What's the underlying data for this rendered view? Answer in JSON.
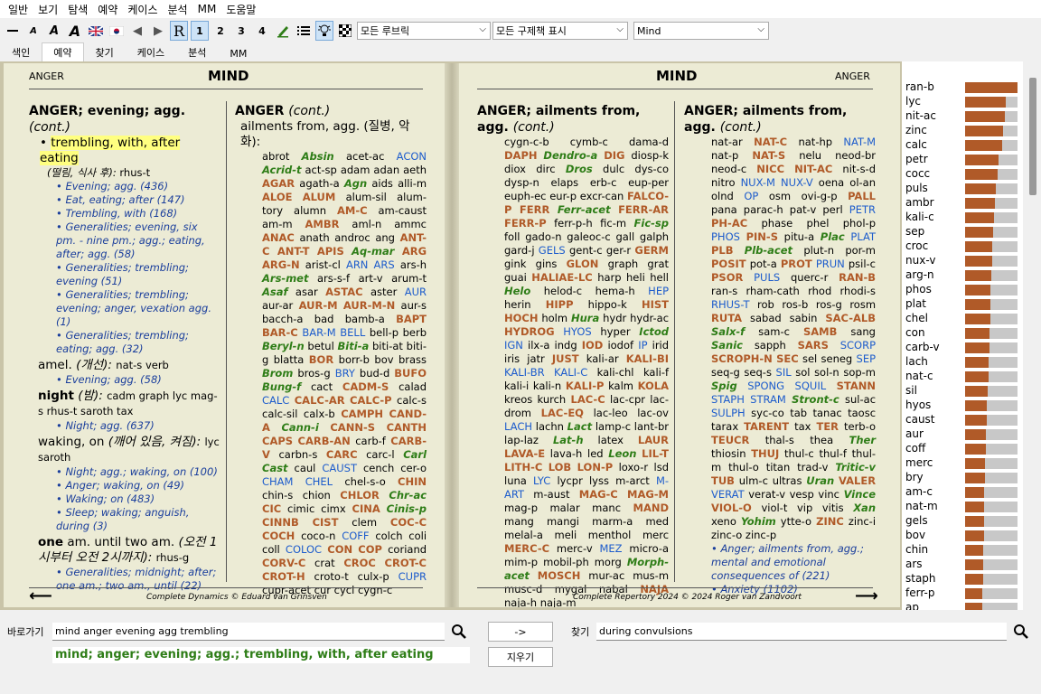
{
  "menu": [
    "일반",
    "보기",
    "탐색",
    "예약",
    "케이스",
    "분석",
    "MM",
    "도움말"
  ],
  "toolbar": {
    "r": "R",
    "n1": "1",
    "n2": "2",
    "n3": "3",
    "n4": "4",
    "rubric_select": "모든 루브릭",
    "remedy_select": "모든 구제책 표시",
    "chapter_select": "Mind"
  },
  "tabs": [
    "색인",
    "예약",
    "찾기",
    "케이스",
    "분석",
    "MM"
  ],
  "left_page": {
    "header_left": "ANGER",
    "title": "MIND",
    "col1": [
      {
        "t": "hd",
        "html": "ANGER; evening; agg. <i>(cont.)</i>"
      },
      {
        "t": "sel",
        "html": "• <span class='hl'>trembling, with, after eating</span>"
      },
      {
        "t": "p",
        "html": "<i style='padding-left:10px'>(떨림, 식사 후):</i> rhus-t"
      },
      {
        "t": "x",
        "html": "• Evening; agg. (436)"
      },
      {
        "t": "x",
        "html": "• Eat, eating; after (147)"
      },
      {
        "t": "x",
        "html": "• Trembling, with (168)"
      },
      {
        "t": "x",
        "html": "• Generalities; evening, six pm. - nine pm.; agg.; eating, after; agg. (58)"
      },
      {
        "t": "x",
        "html": "• Generalities; trembling; evening (51)"
      },
      {
        "t": "x",
        "html": "• Generalities; trembling; evening; anger, vexation agg. (1)"
      },
      {
        "t": "x",
        "html": "• Generalities; trembling; eating; agg. (32)"
      },
      {
        "t": "sub",
        "html": "amel. <i>(개선):</i> nat-s verb"
      },
      {
        "t": "x",
        "html": "• Evening; agg. (58)"
      },
      {
        "t": "sub",
        "html": "<b>night</b> <i>(밤):</i> cadm graph lyc mag-s rhus-t saroth tax"
      },
      {
        "t": "x",
        "html": "• Night; agg. (637)"
      },
      {
        "t": "sub",
        "html": "waking, on <i>(깨어 있음, 켜짐):</i> lyc saroth"
      },
      {
        "t": "x",
        "html": "• Night; agg.; waking, on (100)"
      },
      {
        "t": "x",
        "html": "• Anger; waking, on (49)"
      },
      {
        "t": "x",
        "html": "• Waking; on (483)"
      },
      {
        "t": "x",
        "html": "• Sleep; waking; anguish, during (3)"
      },
      {
        "t": "sub",
        "html": "<b>one</b> am. until two am. <i>(오전 1시부터 오전 2시까지):</i> rhus-g"
      },
      {
        "t": "x",
        "html": "• Generalities; midnight; after; one am.; two am., until (22)"
      }
    ],
    "col2_head": "ANGER (cont.)",
    "col2_sub": "ailments from, agg. (질병, 악화):",
    "col2_body": "abrot <g4>Absin</g4> acet-ac <g2>ACON</g2> <g4>Acrid-t</g4> act-sp adam adan aeth <g3>AGAR</g3> agath-a <g4>Agn</g4> aids alli-m <g3>ALOE ALUM</g3> alum-sil alum-tory alumn <g3>AM-C</g3> am-caust am-m <g3>AMBR</g3> aml-n ammc <g3>ANAC</g3> anath androc ang <g3>ANT-C ANT-T APIS</g3> <g4>Aq-mar</g4> <g3>ARG ARG-N</g3> arist-cl <g2>ARN ARS</g2> ars-h <g4>Ars-met</g4> ars-s-f art-v arum-t <g4>Asaf</g4> asar <g3>ASTAC</g3> aster <g2>AUR</g2> aur-ar <g3>AUR-M AUR-M-N</g3> aur-s bacch-a bad bamb-a <g3>BAPT BAR-C</g3> <g2>BAR-M BELL</g2> bell-p berb <g4>Beryl-n</g4> betul <g4>Biti-a</g4> biti-at biti-g blatta <g3>BOR</g3> borr-b bov brass <g4>Brom</g4> bros-g <g2>BRY</g2> bud-d <g3>BUFO</g3> <g4>Bung-f</g4> cact <g3>CADM-S</g3> calad <g2>CALC</g2> <g3>CALC-AR CALC-P</g3> calc-s calc-sil calx-b <g3>CAMPH CAND-A</g3> <g4>Cann-i</g4> <g3>CANN-S CANTH CAPS CARB-AN</g3> carb-f <g3>CARB-V</g3> carbn-s <g3>CARC</g3> carc-l <g4>Carl Cast</g4> caul <g2>CAUST</g2> cench cer-o <g2>CHAM CHEL</g2> chel-s-o <g3>CHIN</g3> chin-s chion <g3>CHLOR</g3> <g4>Chr-ac</g4> <g3>CIC</g3> cimic cimx <g3>CINA</g3> <g4>Cinis-p</g4> <g3>CINNB CIST</g3> clem <g3>COC-C COCH</g3> coco-n <g2>COFF</g2> colch coli coll <g2>COLOC</g2> <g3>CON COP</g3> coriand <g3>CORV-C</g3> crat <g3>CROC CROT-C CROT-H</g3> croto-t culx-p <g2>CUPR</g2> cupr-acet cur cycl cygn-c",
    "footer": "Complete Dynamics © Eduard van Grinsven"
  },
  "right_page": {
    "title": "MIND",
    "header_right": "ANGER",
    "col1_head": "ANGER; ailments from, agg. (cont.)",
    "col1_body": "cygn-c-b cymb-c dama-d <g3>DAPH</g3> <g4>Dendro-a</g4> <g3>DIG</g3> diosp-k diox dirc <g4>Dros</g4> dulc dys-co dysp-n elaps erb-c eup-per euph-ec eur-p excr-can <g3>FALCO-P FERR</g3> <g4>Ferr-acet</g4> <g3>FERR-AR FERR-P</g3> ferr-p-h fic-m <g4>Fic-sp</g4> foll gado-n galeoc-c gall galph gard-j <g2>GELS</g2> gent-c ger-r <g3>GERM</g3> gink gins <g3>GLON</g3> graph grat guai <g3>HALIAE-LC</g3> harp heli hell <g4>Helo</g4> helod-c hema-h <g2>HEP</g2> herin <g3>HIPP</g3> hippo-k <g3>HIST HOCH</g3> holm <g4>Hura</g4> hydr hydr-ac <g3>HYDROG</g3> <g2>HYOS</g2> hyper <g4>Ictod</g4> <g2>IGN</g2> ilx-a indg <g3>IOD</g3> iodof <g2>IP</g2> irid iris jatr <g3>JUST</g3> kali-ar <g3>KALI-BI</g3> <g2>KALI-BR KALI-C</g2> kali-chl kali-f kali-i kali-n <g3>KALI-P</g3> kalm <g3>KOLA</g3> kreos kurch <g3>LAC-C</g3> lac-cpr lac-drom <g3>LAC-EQ</g3> lac-leo lac-ov <g2>LACH</g2> lachn <g4>Lact</g4> lamp-c lant-br lap-laz <g4>Lat-h</g4> latex <g3>LAUR LAVA-E</g3> lava-h led <g4>Leon</g4> <g3>LIL-T LITH-C LOB LON-P</g3> loxo-r lsd luna <g2>LYC</g2> lycpr lyss m-arct <g2>M-ART</g2> m-aust <g3>MAG-C MAG-M</g3> mag-p malar manc <g3>MAND</g3> mang mangi marm-a med melal-a meli menthol merc <g3>MERC-C</g3> merc-v <g2>MEZ</g2> micro-a mim-p mobil-ph morg <g4>Morph-acet</g4> <g3>MOSCH</g3> mur-ac mus-m musc-d mygal nabal <g3>NAJA</g3> naja-h naja-m",
    "col2_head": "ANGER; ailments from, agg. (cont.)",
    "col2_body": "nat-ar <g3>NAT-C</g3> nat-hp <g2>NAT-M</g2> nat-p <g3>NAT-S</g3> nelu neod-br neod-c <g3>NICC NIT-AC</g3> nit-s-d nitro <g2>NUX-M NUX-V</g2> oena ol-an olnd <g2>OP</g2> osm ovi-g-p <g3>PALL</g3> pana parac-h pat-v perl <g2>PETR</g2> <g3>PH-AC</g3> phase phel phol-p <g2>PHOS</g2> <g3>PIN-S</g3> pitu-a <g4>Plac</g4> <g2>PLAT</g2> <g3>PLB</g3> <g4>Plb-acet</g4> plut-n por-m <g3>POSIT</g3> pot-a <g3>PROT</g3> <g2>PRUN</g2> psil-c <g3>PSOR</g3> <g2>PULS</g2> querc-r <g3>RAN-B</g3> ran-s rham-cath rhod rhodi-s <g2>RHUS-T</g2> rob ros-b ros-g rosm <g3>RUTA</g3> sabad sabin <g3>SAC-ALB</g3> <g4>Salx-f</g4> sam-c <g3>SAMB</g3> sang <g4>Sanic</g4> sapph <g3>SARS</g3> <g2>SCORP</g2> <g3>SCROPH-N SEC</g3> sel seneg <g2>SEP</g2> seq-g seq-s <g2>SIL</g2> sol sol-n sop-m <g4>Spig</g4> <g2>SPONG SQUIL</g2> <g3>STANN</g3> <g2>STAPH STRAM</g2> <g4>Stront-c</g4> sul-ac <g2>SULPH</g2> syc-co tab tanac taosc tarax <g3>TARENT</g3> tax <g3>TER</g3> terb-o <g3>TEUCR</g3> thal-s thea <g4>Ther</g4> thiosin <g3>THUJ</g3> thul-c thul-f thul-m thul-o titan trad-v <g4>Tritic-v</g4> <g3>TUB</g3> ulm-c ultras <g4>Uran</g4> <g3>VALER</g3> <g2>VERAT</g2> verat-v vesp vinc <g4>Vince</g4> <g3>VIOL-O</g3> viol-t vip vitis <g4>Xan</g4> xeno <g4>Yohim</g4> ytte-o <g3>ZINC</g3> zinc-i zinc-o zinc-p",
    "col2_xrefs": [
      "• Anger; ailments from, agg.; mental and emotional consequences of (221)",
      "• Anxiety (1102)"
    ],
    "footer": "Complete Repertory 2024 © 2024 Roger van Zandvoort"
  },
  "chart_data": {
    "type": "bar",
    "categories": [
      "ran-b",
      "lyc",
      "nit-ac",
      "zinc",
      "calc",
      "petr",
      "cocc",
      "puls",
      "ambr",
      "kali-c",
      "sep",
      "croc",
      "nux-v",
      "arg-n",
      "phos",
      "plat",
      "chel",
      "con",
      "carb-v",
      "lach",
      "nat-c",
      "sil",
      "hyos",
      "caust",
      "aur",
      "coff",
      "merc",
      "bry",
      "am-c",
      "nat-m",
      "gels",
      "bov",
      "chin",
      "ars",
      "staph",
      "ferr-p",
      "ap"
    ],
    "values": [
      1.0,
      0.78,
      0.75,
      0.73,
      0.7,
      0.63,
      0.62,
      0.59,
      0.57,
      0.55,
      0.53,
      0.52,
      0.51,
      0.5,
      0.49,
      0.49,
      0.48,
      0.47,
      0.46,
      0.45,
      0.44,
      0.43,
      0.42,
      0.41,
      0.4,
      0.39,
      0.38,
      0.38,
      0.37,
      0.37,
      0.36,
      0.36,
      0.35,
      0.35,
      0.34,
      0.33,
      0.33
    ],
    "fill_color": "#b05a28",
    "track_color": "#c8c8c8"
  },
  "bottom": {
    "goto_label": "바로가기",
    "goto_value": "mind anger evening agg trembling",
    "arrow_button": "->",
    "find_label": "찾기",
    "find_value": "during convulsions",
    "clear_button": "지우기",
    "result": "mind; anger; evening; agg.; trembling, with, after eating"
  }
}
